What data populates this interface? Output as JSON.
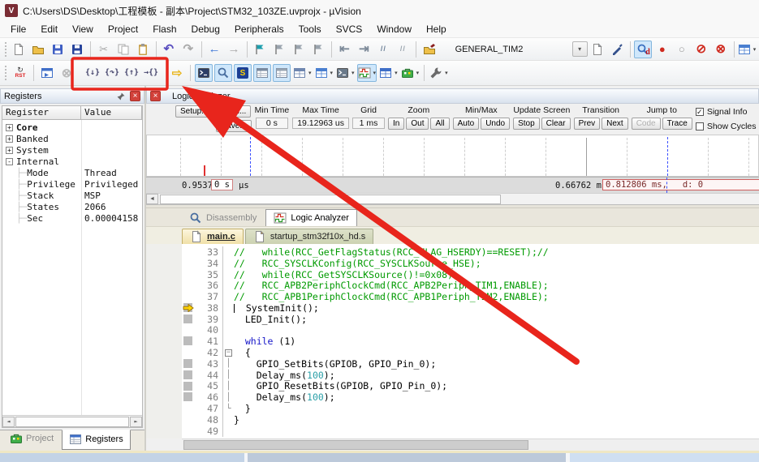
{
  "window": {
    "title": "C:\\Users\\DS\\Desktop\\工程模板 - 副本\\Project\\STM32_103ZE.uvprojx - µVision",
    "app_icon_text": "V"
  },
  "menu_bar": {
    "items": [
      "File",
      "Edit",
      "View",
      "Project",
      "Flash",
      "Debug",
      "Peripherals",
      "Tools",
      "SVCS",
      "Window",
      "Help"
    ]
  },
  "toolbar_top": {
    "target_select": {
      "value": "GENERAL_TIM2"
    },
    "icons": [
      {
        "n": "new-file-icon",
        "svg": "page",
        "c": "#dadee6"
      },
      {
        "n": "open-folder-icon",
        "svg": "folder",
        "c": "#eec04a"
      },
      {
        "n": "save-icon",
        "svg": "floppy",
        "c": "#3f5fc4"
      },
      {
        "n": "save-all-icon",
        "svg": "floppy",
        "c": "#27449c"
      },
      {
        "sep": 1
      },
      {
        "n": "cut-icon",
        "g": "✂",
        "c": "#a8a8a8"
      },
      {
        "n": "copy-icon",
        "svg": "copy",
        "c": "#a8a8a8"
      },
      {
        "n": "paste-icon",
        "svg": "clipboard",
        "c": "#c8a048"
      },
      {
        "sep": 1
      },
      {
        "n": "undo-icon",
        "g": "↶",
        "c": "#5a4fc0",
        "b": 1
      },
      {
        "n": "redo-icon",
        "g": "↷",
        "c": "#ababab",
        "b": 1
      },
      {
        "sep": 1
      },
      {
        "n": "back-icon",
        "g": "←",
        "c": "#3d76d6",
        "b": 1
      },
      {
        "n": "forward-icon",
        "g": "→",
        "c": "#ababab",
        "b": 1
      },
      {
        "sep": 1
      },
      {
        "n": "insert-bookmark-icon",
        "svg": "flag",
        "c": "#1d9fae"
      },
      {
        "n": "previous-bookmark-icon",
        "svg": "flag",
        "c": "#9aa4ae"
      },
      {
        "n": "next-bookmark-icon",
        "svg": "flag",
        "c": "#9aa4ae"
      },
      {
        "n": "clear-bookmarks-icon",
        "svg": "flag",
        "c": "#9aa4ae"
      },
      {
        "sep": 1
      },
      {
        "n": "unindent-icon",
        "g": "⇤",
        "c": "#7d8a99",
        "b": 1
      },
      {
        "n": "indent-icon",
        "g": "⇥",
        "c": "#7d8a99",
        "b": 1
      },
      {
        "n": "comment-icon",
        "g": "//",
        "c": "#6b7f96",
        "sm": 1
      },
      {
        "n": "uncomment-icon",
        "g": "//",
        "c": "#9aa4ae",
        "sm": 1
      },
      {
        "sep": 1
      },
      {
        "n": "target-options-icon",
        "svg": "folderpen",
        "c": "#eec04a"
      },
      {
        "combo": 1
      },
      {
        "n": "file-extensions-icon",
        "svg": "page",
        "c": "#9db4d8"
      },
      {
        "n": "manage-environment-icon",
        "svg": "pen",
        "c": "#33508c"
      },
      {
        "sep": 1
      },
      {
        "n": "start-stop-debug-icon",
        "svg": "mag",
        "c": "#3a6fc0",
        "ov": "d",
        "hl": 1
      },
      {
        "n": "insert-breakpoint-icon",
        "g": "●",
        "c": "#cf2a1f"
      },
      {
        "n": "enable-breakpoint-icon",
        "g": "○",
        "c": "#9a9a9a"
      },
      {
        "n": "disable-all-breakpoints-icon",
        "g": "⊘",
        "c": "#cf2a1f",
        "b": 1
      },
      {
        "n": "kill-all-breakpoints-icon",
        "g": "⊗",
        "c": "#cf2a1f",
        "b": 1
      },
      {
        "sep": 1
      },
      {
        "n": "window-layout-icon",
        "svg": "grid",
        "c": "#4a7fd0",
        "dd": 1
      }
    ]
  },
  "toolbar_debug": {
    "reset_label": "RST",
    "icons": [
      {
        "n": "reset-icon",
        "rst": 1
      },
      {
        "sep": 1
      },
      {
        "n": "run-icon",
        "svg": "runwin",
        "c": "#3f6fc8"
      },
      {
        "n": "stop-icon",
        "g": "⊗",
        "c": "#b9b9b9",
        "b": 1
      },
      {
        "gap": 1
      },
      {
        "n": "step-into-icon",
        "g": "{↓}",
        "c": "#46466e",
        "st": 1
      },
      {
        "n": "step-over-icon",
        "g": "{↷}",
        "c": "#46466e",
        "st": 1
      },
      {
        "n": "step-out-icon",
        "g": "{↑}",
        "c": "#46466e",
        "st": 1
      },
      {
        "n": "run-to-cursor-icon",
        "g": "→{}",
        "c": "#46466e",
        "st": 1
      },
      {
        "gap": 1
      },
      {
        "n": "show-current-statement-icon",
        "g": "⇨",
        "c": "#e8b61e",
        "b": 1
      },
      {
        "sep": 1
      },
      {
        "n": "command-window-icon",
        "svg": "console",
        "c": "#2c3e66",
        "hl": 1
      },
      {
        "n": "disassembly-window-icon",
        "svg": "mag",
        "c": "#4a6fa0",
        "hl": 1
      },
      {
        "n": "symbol-window-icon",
        "sym": 1,
        "hl": 1
      },
      {
        "n": "registers-window-icon",
        "svg": "table",
        "c": "#7a8aa0",
        "hl": 1
      },
      {
        "n": "call-stack-window-icon",
        "svg": "table",
        "c": "#98a4b2",
        "hl": 1
      },
      {
        "n": "watch-window-icon",
        "svg": "grid",
        "c": "#6f87b0",
        "dd": 1
      },
      {
        "n": "memory-window-icon",
        "svg": "grid",
        "c": "#4a7fd0",
        "dd": 1
      },
      {
        "n": "serial-window-icon",
        "svg": "console",
        "c": "#6a7a8a",
        "dd": 1
      },
      {
        "n": "analysis-window-icon",
        "svg": "wave",
        "dd": 1,
        "hl": 1
      },
      {
        "n": "system-viewer-icon",
        "svg": "grid",
        "c": "#3f6fc8",
        "dd": 1
      },
      {
        "n": "toolbox-icon",
        "svg": "toolbox",
        "dd": 1
      },
      {
        "sep": 1
      },
      {
        "n": "debug-settings-icon",
        "svg": "wrench",
        "c": "#6a6a6a",
        "dd": 1
      }
    ]
  },
  "registers": {
    "title": "Registers",
    "columns": [
      "Register",
      "Value"
    ],
    "rows": [
      {
        "toggle": "+",
        "name": "Core",
        "value": "",
        "bold": true,
        "level": 0
      },
      {
        "toggle": "+",
        "name": "Banked",
        "value": "",
        "level": 0
      },
      {
        "toggle": "+",
        "name": "System",
        "value": "",
        "level": 0
      },
      {
        "toggle": "-",
        "name": "Internal",
        "value": "",
        "level": 0
      },
      {
        "toggle": "",
        "name": "Mode",
        "value": "Thread",
        "level": 1
      },
      {
        "toggle": "",
        "name": "Privilege",
        "value": "Privileged",
        "level": 1
      },
      {
        "toggle": "",
        "name": "Stack",
        "value": "MSP",
        "level": 1
      },
      {
        "toggle": "",
        "name": "States",
        "value": "2066",
        "level": 1
      },
      {
        "toggle": "",
        "name": "Sec",
        "value": "0.00004158",
        "level": 1
      }
    ],
    "tabs": [
      {
        "label": "Project",
        "icon": "project-icon"
      },
      {
        "label": "Registers",
        "icon": "registers-icon",
        "active": true
      }
    ]
  },
  "logic_analyzer": {
    "title": "Logic Analyzer",
    "setup_button": "Setup...",
    "load_button": "Load...",
    "save_button": "Save...",
    "fields": [
      {
        "label": "Min Time",
        "value": "0 s"
      },
      {
        "label": "Max Time",
        "value": "19.12963 us"
      },
      {
        "label": "Grid",
        "value": "1 ms"
      }
    ],
    "button_groups": [
      {
        "label": "Zoom",
        "buttons": [
          {
            "label": "In"
          },
          {
            "label": "Out"
          },
          {
            "label": "All"
          }
        ]
      },
      {
        "label": "Min/Max",
        "buttons": [
          {
            "label": "Auto"
          },
          {
            "label": "Undo"
          }
        ]
      },
      {
        "label": "Update Screen",
        "buttons": [
          {
            "label": "Stop"
          },
          {
            "label": "Clear"
          }
        ]
      },
      {
        "label": "Transition",
        "buttons": [
          {
            "label": "Prev"
          },
          {
            "label": "Next"
          }
        ]
      },
      {
        "label": "Jump to",
        "buttons": [
          {
            "label": "Code",
            "disabled": true
          },
          {
            "label": "Trace"
          }
        ]
      }
    ],
    "checkboxes": [
      {
        "label": "Signal Info",
        "checked": true
      },
      {
        "label": "Show Cycles",
        "checked": false
      }
    ],
    "timeline": {
      "start_time": "0.95370",
      "cursor_time": "0 s",
      "unit_suffix": "µs",
      "mid_time": "0.66762 ms",
      "selection": "0.812806 ms,   d: 0"
    }
  },
  "dock_tabs": [
    {
      "label": "Disassembly",
      "icon": "disassembly-icon"
    },
    {
      "label": "Logic Analyzer",
      "icon": "logic-analyzer-icon",
      "active": true
    }
  ],
  "editor": {
    "tabs": [
      {
        "label": "main.c",
        "icon": "file-icon",
        "active": true
      },
      {
        "label": "startup_stm32f10x_hd.s",
        "icon": "file-key-icon"
      }
    ],
    "lines": [
      {
        "n": 33,
        "segs": [
          [
            "//   while(RCC_GetFlagStatus(RCC_FLAG_HSERDY)==RESET);//",
            "cm"
          ]
        ]
      },
      {
        "n": 34,
        "segs": [
          [
            "//   RCC_SYSCLKConfig(RCC_SYSCLKSource_HSE);",
            "cm"
          ]
        ]
      },
      {
        "n": 35,
        "segs": [
          [
            "//   while(RCC_GetSYSCLKSource()!=0x08);",
            "cm"
          ]
        ]
      },
      {
        "n": 36,
        "segs": [
          [
            "//   RCC_APB2PeriphClockCmd(RCC_APB2Periph_TIM1,ENABLE);",
            "cm"
          ]
        ]
      },
      {
        "n": 37,
        "segs": [
          [
            "//   RCC_APB1PeriphClockCmd(RCC_APB1Periph_TIM2,ENABLE);",
            "cm"
          ]
        ]
      },
      {
        "n": 38,
        "exec": true,
        "pc": true,
        "caret": true,
        "segs": [
          [
            "  SystemInit();",
            "pl"
          ]
        ]
      },
      {
        "n": 39,
        "exec": true,
        "segs": [
          [
            "  LED_Init();",
            "pl"
          ]
        ]
      },
      {
        "n": 40,
        "segs": []
      },
      {
        "n": 41,
        "exec": true,
        "segs": [
          [
            "  ",
            "pl"
          ],
          [
            "while",
            "kw"
          ],
          [
            " (1)",
            "pl"
          ]
        ]
      },
      {
        "n": 42,
        "fold": "start",
        "segs": [
          [
            "  {",
            "pl"
          ]
        ]
      },
      {
        "n": 43,
        "exec": true,
        "fold": "mid",
        "segs": [
          [
            "    GPIO_SetBits(GPIOB, GPIO_Pin_0);",
            "pl"
          ]
        ]
      },
      {
        "n": 44,
        "exec": true,
        "fold": "mid",
        "segs": [
          [
            "    Delay_ms(",
            "pl"
          ],
          [
            "100",
            "nm"
          ],
          [
            ");",
            "pl"
          ]
        ]
      },
      {
        "n": 45,
        "exec": true,
        "fold": "mid",
        "segs": [
          [
            "    GPIO_ResetBits(GPIOB, GPIO_Pin_0);",
            "pl"
          ]
        ]
      },
      {
        "n": 46,
        "exec": true,
        "fold": "mid",
        "segs": [
          [
            "    Delay_ms(",
            "pl"
          ],
          [
            "100",
            "nm"
          ],
          [
            ");",
            "pl"
          ]
        ]
      },
      {
        "n": 47,
        "fold": "end",
        "segs": [
          [
            "  }",
            "pl"
          ]
        ]
      },
      {
        "n": 48,
        "segs": [
          [
            "}",
            "pl"
          ]
        ]
      },
      {
        "n": 49,
        "segs": []
      }
    ]
  },
  "colors": {
    "annotation_red": "#e8251c",
    "toggle_highlight": "#cfe7fb",
    "comment_green": "#009a00",
    "keyword_blue": "#1414c8",
    "number_teal": "#2ba0a8"
  }
}
